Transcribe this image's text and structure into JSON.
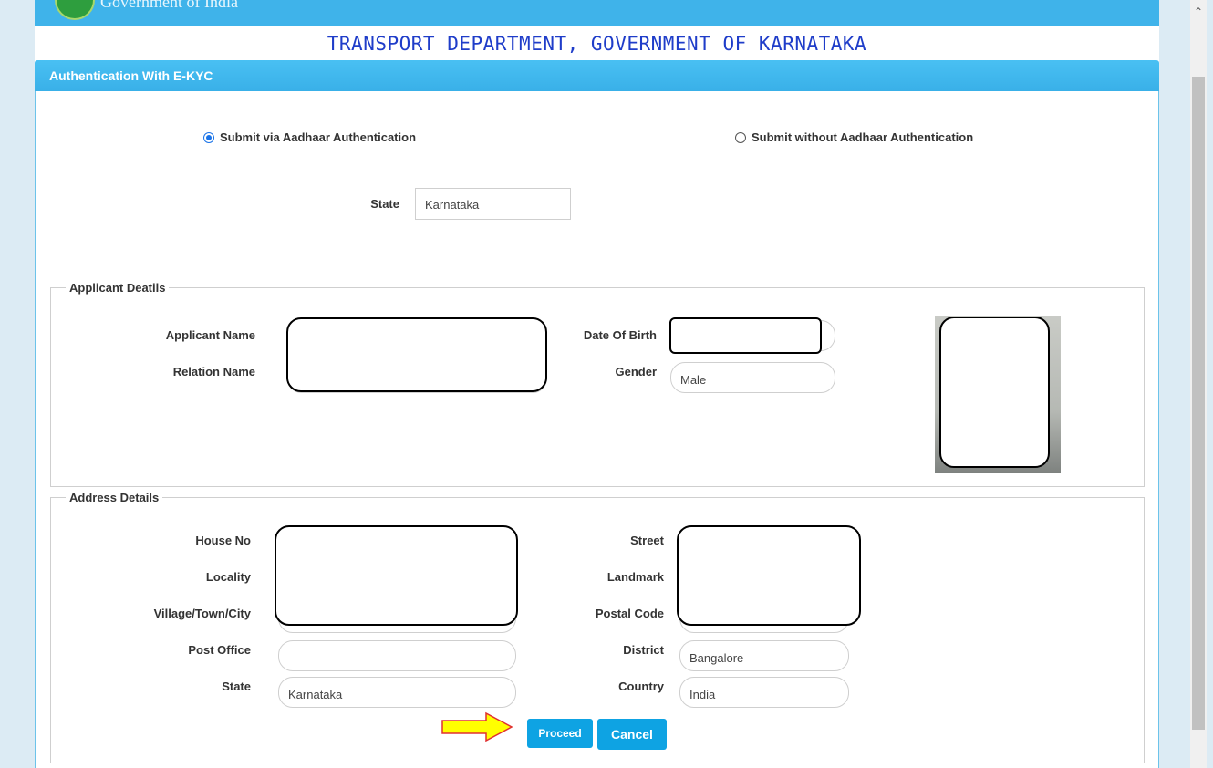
{
  "header": {
    "gov_text": "Government of India",
    "dept_title": "TRANSPORT DEPARTMENT, GOVERNMENT OF KARNATAKA"
  },
  "panel": {
    "title": "Authentication With E-KYC"
  },
  "auth_options": {
    "with_aadhaar": "Submit via Aadhaar Authentication",
    "without_aadhaar": "Submit without Aadhaar Authentication",
    "selected": "with_aadhaar"
  },
  "state_select": {
    "label": "State",
    "value": "Karnataka"
  },
  "applicant": {
    "legend": "Applicant Deatils",
    "name_label": "Applicant Name",
    "relation_label": "Relation Name",
    "dob_label": "Date Of Birth",
    "gender_label": "Gender",
    "gender_value": "Male"
  },
  "address": {
    "legend": "Address Details",
    "house_label": "House No",
    "locality_label": "Locality",
    "village_label": "Village/Town/City",
    "post_office_label": "Post Office",
    "state_label": "State",
    "state_value": "Karnataka",
    "street_label": "Street",
    "landmark_label": "Landmark",
    "postal_label": "Postal Code",
    "district_label": "District",
    "district_value": "Bangalore",
    "country_label": "Country",
    "country_value": "India"
  },
  "actions": {
    "proceed": "Proceed",
    "cancel": "Cancel"
  },
  "colors": {
    "header_blue": "#3fb3ea",
    "title_blue": "#1f3dc9",
    "button_blue": "#0ea3e3",
    "arrow_fill": "#ffff00",
    "arrow_stroke": "#e03030"
  }
}
